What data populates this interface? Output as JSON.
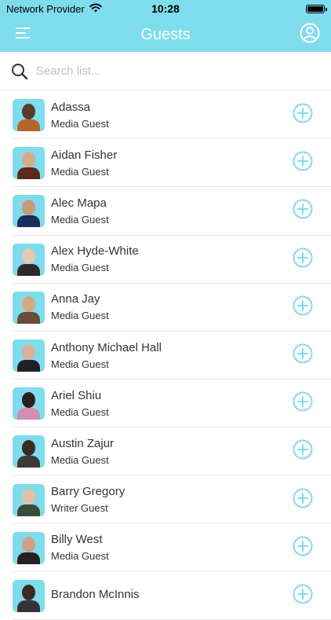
{
  "status_bar": {
    "carrier": "Network Provider",
    "time": "10:28"
  },
  "nav": {
    "title": "Guests"
  },
  "search": {
    "placeholder": "Search list..."
  },
  "guests": [
    {
      "name": "Adassa",
      "type": "Media Guest",
      "head": "#5a3a28",
      "body": "#b5652b"
    },
    {
      "name": "Aidan Fisher",
      "type": "Media Guest",
      "head": "#d6a98a",
      "body": "#5b2a1d"
    },
    {
      "name": "Alec Mapa",
      "type": "Media Guest",
      "head": "#c99a76",
      "body": "#1b2d5c"
    },
    {
      "name": "Alex Hyde-White",
      "type": "Media Guest",
      "head": "#e4c8b4",
      "body": "#2a2a2a"
    },
    {
      "name": "Anna Jay",
      "type": "Media Guest",
      "head": "#d6a97e",
      "body": "#6b4a3a"
    },
    {
      "name": "Anthony Michael Hall",
      "type": "Media Guest",
      "head": "#d9b09a",
      "body": "#1f1f24"
    },
    {
      "name": "Ariel Shiu",
      "type": "Media Guest",
      "head": "#2a1f1f",
      "body": "#d08fb0"
    },
    {
      "name": "Austin Zajur",
      "type": "Media Guest",
      "head": "#3a2a22",
      "body": "#3e3a38"
    },
    {
      "name": "Barry Gregory",
      "type": "Writer Guest",
      "head": "#e2c0a8",
      "body": "#3b4a3a"
    },
    {
      "name": "Billy West",
      "type": "Media Guest",
      "head": "#cfa08a",
      "body": "#222222"
    },
    {
      "name": "Brandon McInnis",
      "type": "",
      "head": "#3b2a22",
      "body": "#333333"
    }
  ],
  "colors": {
    "accent": "#7fdced",
    "text": "#333333",
    "placeholder": "#bfbfbf"
  }
}
